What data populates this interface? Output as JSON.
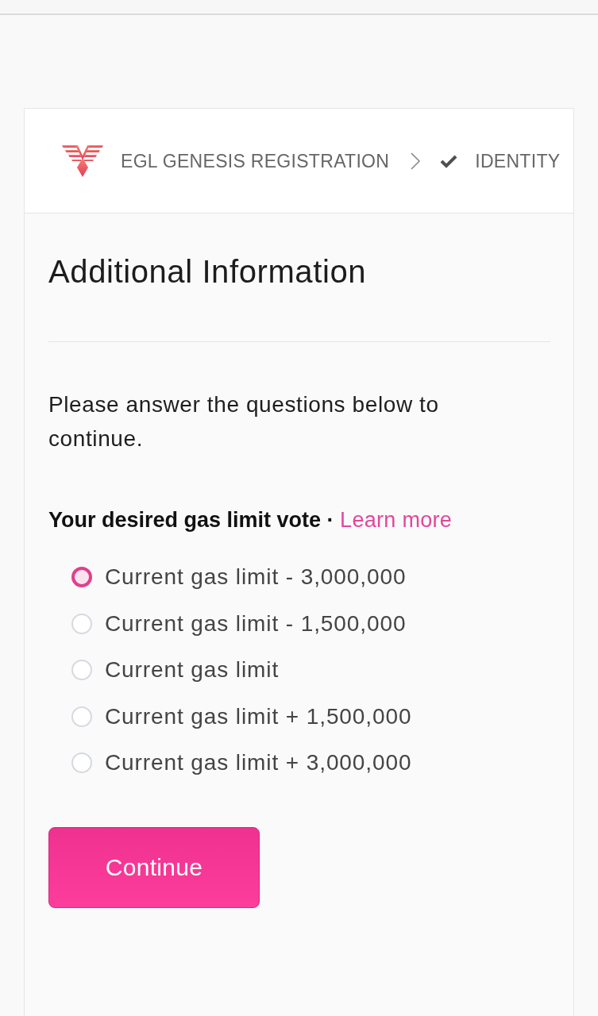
{
  "breadcrumb": [
    {
      "label": "EGL GENESIS REGISTRATION",
      "completed": false
    },
    {
      "label": "IDENTITY",
      "completed": true
    }
  ],
  "title": "Additional Information",
  "intro": "Please answer the questions below to continue.",
  "question": {
    "label": "Your desired gas limit vote ·",
    "link": "Learn more",
    "options": [
      {
        "label": "Current gas limit - 3,000,000",
        "selected": false,
        "focused": true
      },
      {
        "label": "Current gas limit - 1,500,000",
        "selected": false,
        "focused": false
      },
      {
        "label": "Current gas limit",
        "selected": false,
        "focused": false
      },
      {
        "label": "Current gas limit + 1,500,000",
        "selected": false,
        "focused": false
      },
      {
        "label": "Current gas limit + 3,000,000",
        "selected": false,
        "focused": false
      }
    ]
  },
  "button": "Continue"
}
